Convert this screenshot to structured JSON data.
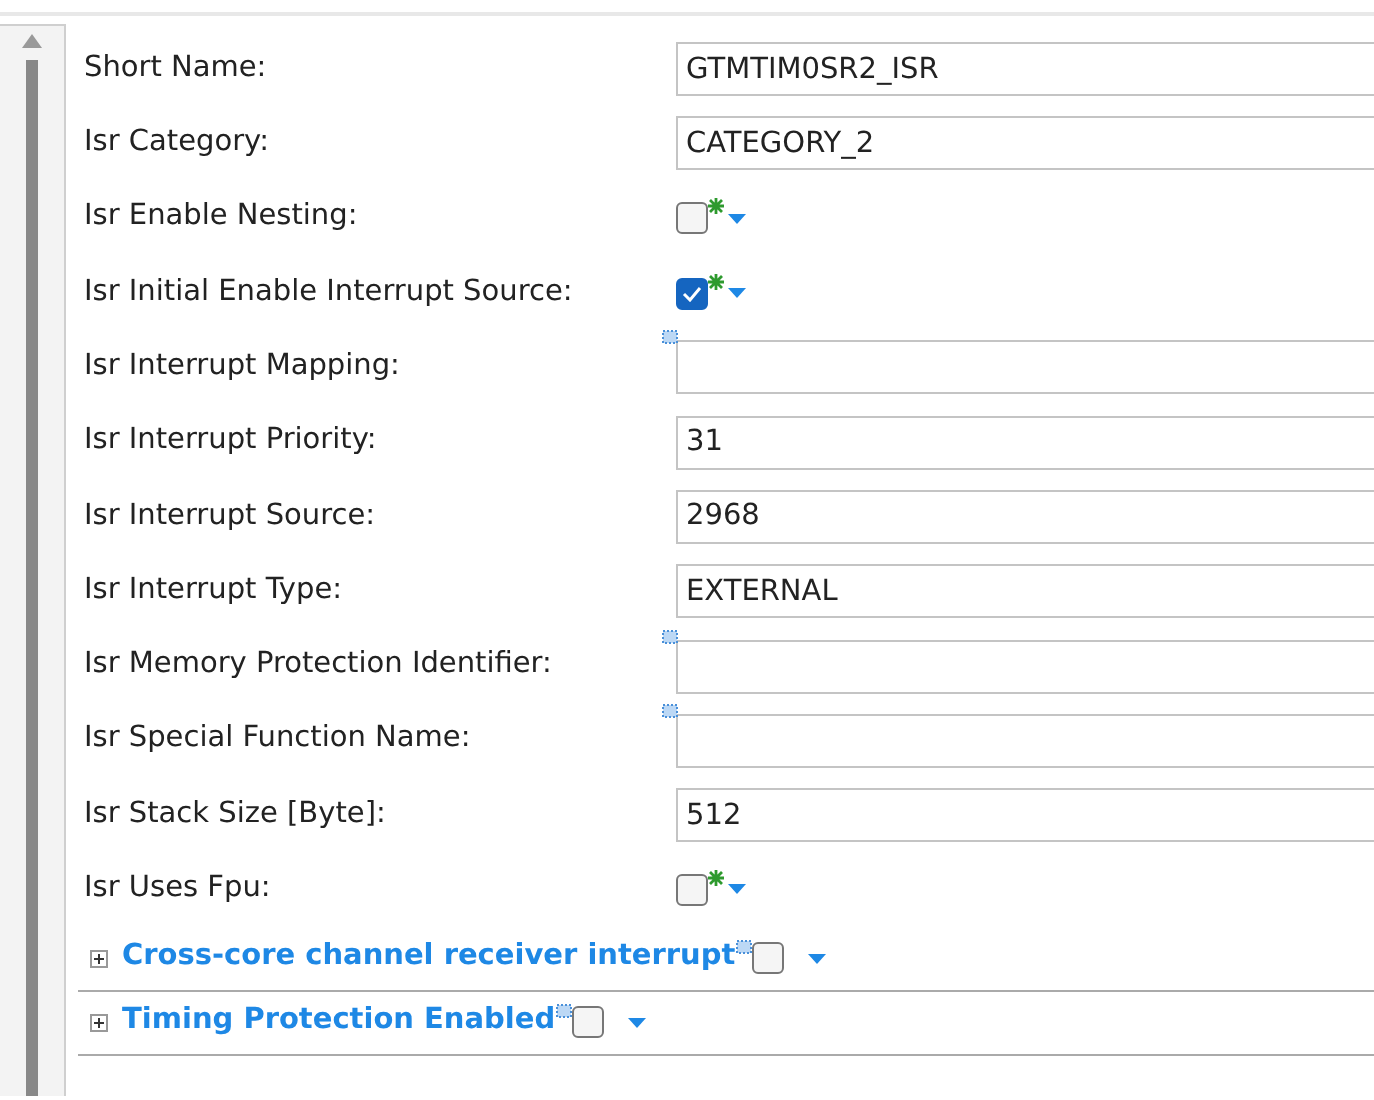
{
  "fields": [
    {
      "label": "Short Name:",
      "kind": "text",
      "value": "GTMTIM0SR2_ISR",
      "marker": false
    },
    {
      "label": "Isr Category:",
      "kind": "text",
      "value": "CATEGORY_2",
      "marker": false
    },
    {
      "label": "Isr Enable Nesting:",
      "kind": "checkbox",
      "checked": false
    },
    {
      "label": "Isr Initial Enable Interrupt Source:",
      "kind": "checkbox",
      "checked": true
    },
    {
      "label": "Isr Interrupt Mapping:",
      "kind": "text",
      "marker": true
    },
    {
      "label": "Isr Interrupt Priority:",
      "kind": "text",
      "value": "31",
      "marker": false
    },
    {
      "label": "Isr Interrupt Source:",
      "kind": "text",
      "value": "2968",
      "marker": false
    },
    {
      "label": "Isr Interrupt Type:",
      "kind": "text",
      "value": "EXTERNAL",
      "marker": false
    },
    {
      "label": "Isr Memory Protection Identifier:",
      "kind": "text",
      "marker": true
    },
    {
      "label": "Isr Special Function Name:",
      "kind": "text",
      "marker": true
    },
    {
      "label": "Isr Stack Size [Byte]:",
      "kind": "text",
      "value": "512",
      "marker": false
    },
    {
      "label": "Isr Uses Fpu:",
      "kind": "checkbox",
      "checked": false
    }
  ],
  "sections": [
    {
      "title": "Cross-core channel receiver interrupt",
      "checked": false
    },
    {
      "title": "Timing Protection Enabled",
      "checked": false
    }
  ]
}
